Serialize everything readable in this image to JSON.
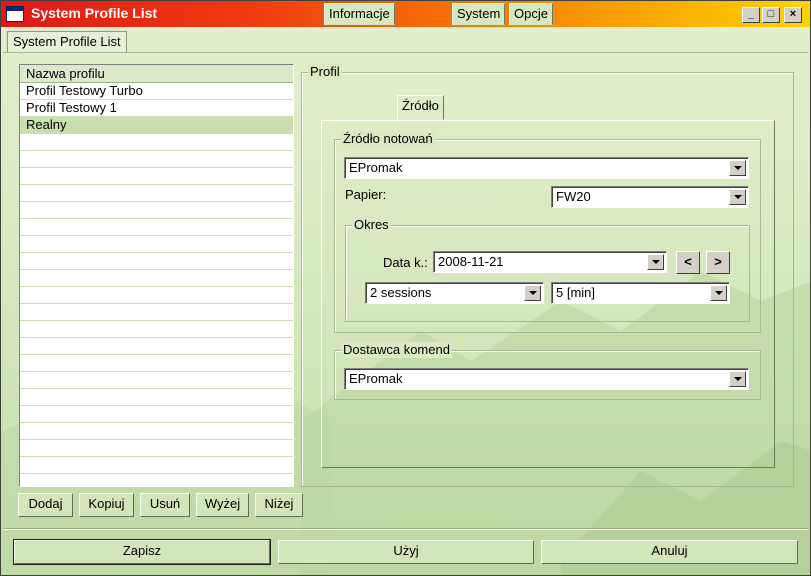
{
  "window": {
    "title": "System Profile List"
  },
  "main_tab": {
    "label": "System Profile List"
  },
  "profile_list": {
    "header": "Nazwa profilu",
    "items": [
      "Profil Testowy Turbo",
      "Profil Testowy 1",
      "Realny"
    ],
    "selected": "Realny"
  },
  "list_buttons": {
    "add": "Dodaj",
    "copy": "Kopiuj",
    "remove": "Usuń",
    "up": "Wyżej",
    "down": "Niżej"
  },
  "profile_group": {
    "label": "Profil",
    "tabs": [
      "Informacje",
      "Źródło",
      "System",
      "Opcje"
    ],
    "active_tab": "Źródło"
  },
  "source": {
    "group_label": "Źródło notowań",
    "provider_value": "EPromak",
    "paper_label": "Papier:",
    "paper_value": "FW20",
    "period": {
      "group_label": "Okres",
      "date_label": "Data k.:",
      "date_value": "2008-11-21",
      "prev_symbol": "<",
      "next_symbol": ">",
      "sessions_value": "2 sessions",
      "interval_value": "5 [min]"
    }
  },
  "commands": {
    "group_label": "Dostawca komend",
    "provider_value": "EPromak"
  },
  "footer": {
    "save": "Zapisz",
    "use": "Użyj",
    "cancel": "Anuluj"
  },
  "colors": {
    "title_start": "#e01818",
    "title_end": "#ffd400",
    "background": "#d9eac2"
  }
}
